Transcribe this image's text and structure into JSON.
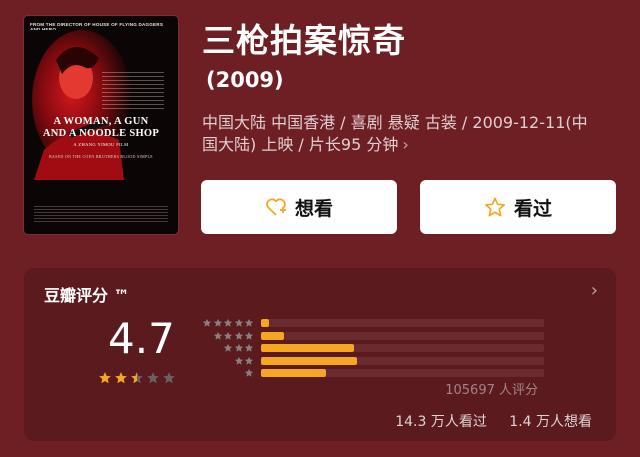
{
  "poster": {
    "director_line": "FROM THE DIRECTOR OF HOUSE OF FLYING DAGGERS AND HERO",
    "title_line1": "A WOMAN, A GUN",
    "title_line2": "AND A NOODLE SHOP",
    "tagline": "A ZHANG YIMOU FILM",
    "based_on": "BASED ON THE COEN BROTHERS BLOOD SIMPLE"
  },
  "movie": {
    "title": "三枪拍案惊奇",
    "year": "(2009)",
    "meta_line1": "中国大陆 中国香港 / 喜剧 悬疑 古装 / 2009-12-11(中",
    "meta_line2": "国大陆) 上映 / 片长95 分钟",
    "meta_chevron": "›"
  },
  "actions": {
    "want_label": "想看",
    "seen_label": "看过"
  },
  "rating": {
    "title": "豆瓣评分 ™",
    "arrow": "›",
    "score": "4.7",
    "score_stars": 2.5,
    "distribution": [
      {
        "stars": 5,
        "fraction": 0.03
      },
      {
        "stars": 4,
        "fraction": 0.08
      },
      {
        "stars": 3,
        "fraction": 0.33
      },
      {
        "stars": 2,
        "fraction": 0.34
      },
      {
        "stars": 1,
        "fraction": 0.23
      }
    ],
    "votes": "105697 人评分",
    "seen_count": "14.3 万人看过",
    "want_count": "1.4 万人想看"
  },
  "colors": {
    "background": "#6e1f24",
    "card": "#5a1a1e",
    "accent": "#f5a623",
    "poster_red": "#c8121a"
  }
}
